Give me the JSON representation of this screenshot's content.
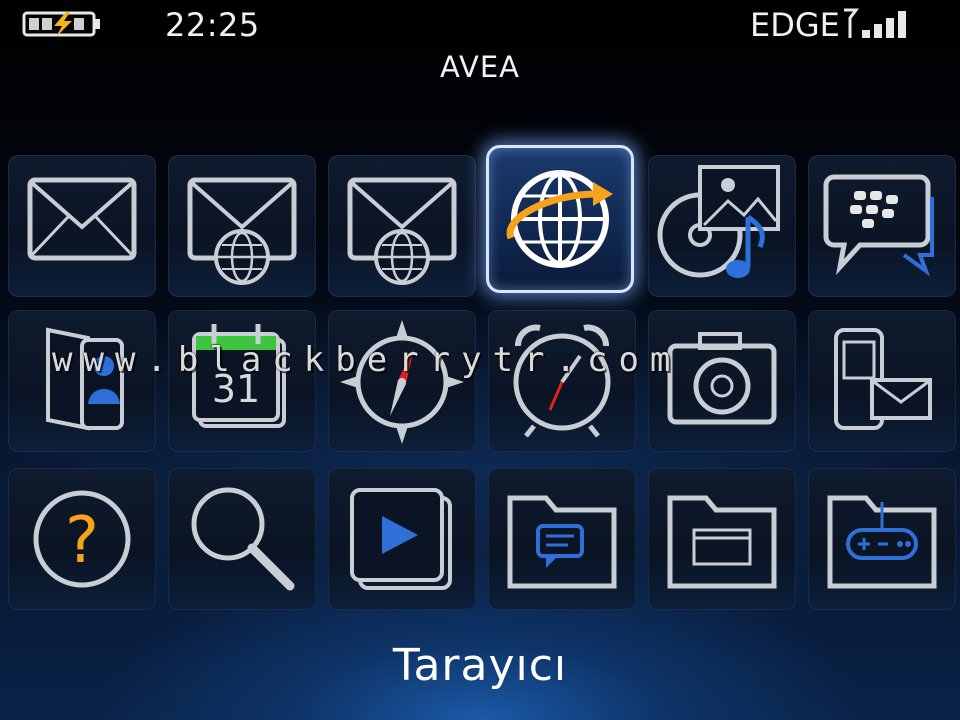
{
  "status": {
    "time": "22:25",
    "network": "EDGE",
    "battery_state": "charging",
    "signal_bars": 4
  },
  "carrier": "AVEA",
  "watermark": "www.blackberrytr.com",
  "selected_label": "Tarayıcı",
  "apps": [
    {
      "icon": "envelope-icon"
    },
    {
      "icon": "envelope-globe-icon"
    },
    {
      "icon": "envelope-globe-icon"
    },
    {
      "icon": "globe-icon",
      "selected": true
    },
    {
      "icon": "media-icon"
    },
    {
      "icon": "bbm-icon"
    },
    {
      "icon": "contacts-icon"
    },
    {
      "icon": "calendar-icon",
      "calendar_day": "31"
    },
    {
      "icon": "compass-icon"
    },
    {
      "icon": "clock-icon"
    },
    {
      "icon": "camera-icon"
    },
    {
      "icon": "phone-messages-icon"
    },
    {
      "icon": "help-icon",
      "glyph": "?"
    },
    {
      "icon": "search-icon"
    },
    {
      "icon": "video-play-icon"
    },
    {
      "icon": "folder-messages-icon"
    },
    {
      "icon": "folder-window-icon"
    },
    {
      "icon": "folder-games-icon"
    }
  ],
  "colors": {
    "accent_blue": "#2f6fd8",
    "accent_orange": "#f4a31a",
    "compass_red": "#e02020",
    "calendar_green": "#3fc43f",
    "icon_stroke": "#c9cdd4"
  }
}
